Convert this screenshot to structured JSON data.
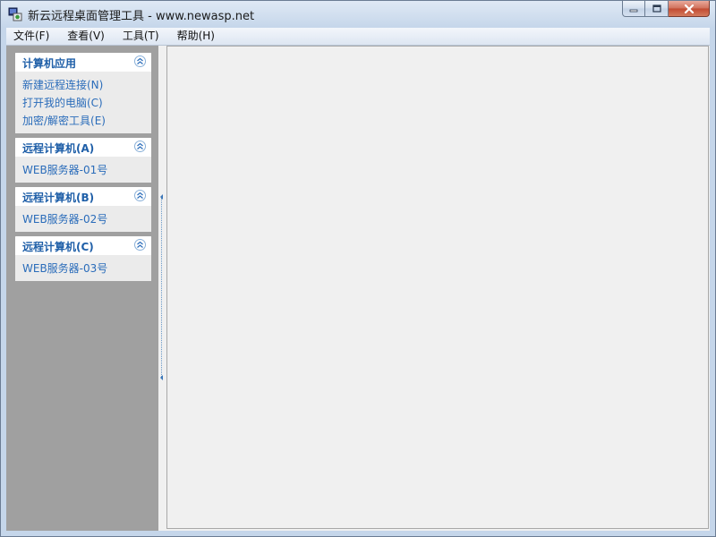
{
  "window": {
    "title": "新云远程桌面管理工具 - www.newasp.net"
  },
  "menu": [
    {
      "label": "文件(F)"
    },
    {
      "label": "查看(V)"
    },
    {
      "label": "工具(T)"
    },
    {
      "label": "帮助(H)"
    }
  ],
  "sidebar": {
    "panels": [
      {
        "title": "计算机应用",
        "items": [
          "新建远程连接(N)",
          "打开我的电脑(C)",
          "加密/解密工具(E)"
        ]
      },
      {
        "title": "远程计算机(A)",
        "items": [
          "WEB服务器-01号"
        ]
      },
      {
        "title": "远程计算机(B)",
        "items": [
          "WEB服务器-02号"
        ]
      },
      {
        "title": "远程计算机(C)",
        "items": [
          "WEB服务器-03号"
        ]
      }
    ]
  },
  "colors": {
    "panel_title": "#1f5fa8",
    "panel_link": "#2a6cba",
    "sidebar_bg": "#a0a0a0"
  }
}
